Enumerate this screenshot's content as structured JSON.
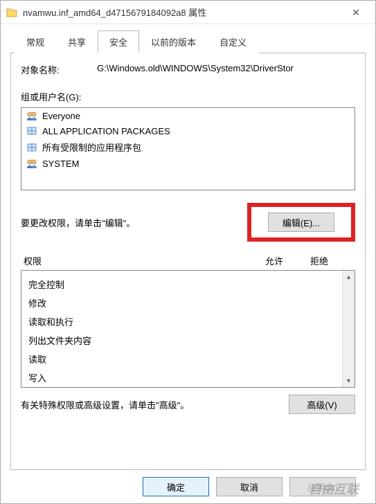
{
  "window": {
    "title": "nvamwu.inf_amd64_d4715679184092a8 属性"
  },
  "tabs": {
    "general": "常规",
    "sharing": "共享",
    "security": "安全",
    "previous": "以前的版本",
    "custom": "自定义"
  },
  "object": {
    "label": "对象名称:",
    "value": "G:\\Windows.old\\WINDOWS\\System32\\DriverStor"
  },
  "groups": {
    "label": "组或用户名(G):",
    "items": [
      {
        "name": "Everyone",
        "icon": "users"
      },
      {
        "name": "ALL APPLICATION PACKAGES",
        "icon": "package"
      },
      {
        "name": "所有受限制的应用程序包",
        "icon": "package"
      },
      {
        "name": "SYSTEM",
        "icon": "users"
      }
    ]
  },
  "edit": {
    "text": "要更改权限，请单击\"编辑\"。",
    "button": "编辑(E)..."
  },
  "permissions": {
    "header_name": "权限",
    "header_allow": "允许",
    "header_deny": "拒绝",
    "items": [
      "完全控制",
      "修改",
      "读取和执行",
      "列出文件夹内容",
      "读取",
      "写入"
    ]
  },
  "advanced": {
    "text": "有关特殊权限或高级设置，请单击\"高级\"。",
    "button": "高级(V)"
  },
  "footer": {
    "ok": "确定",
    "cancel": "取消",
    "apply": "应用(A)"
  },
  "watermark": "自由互联"
}
